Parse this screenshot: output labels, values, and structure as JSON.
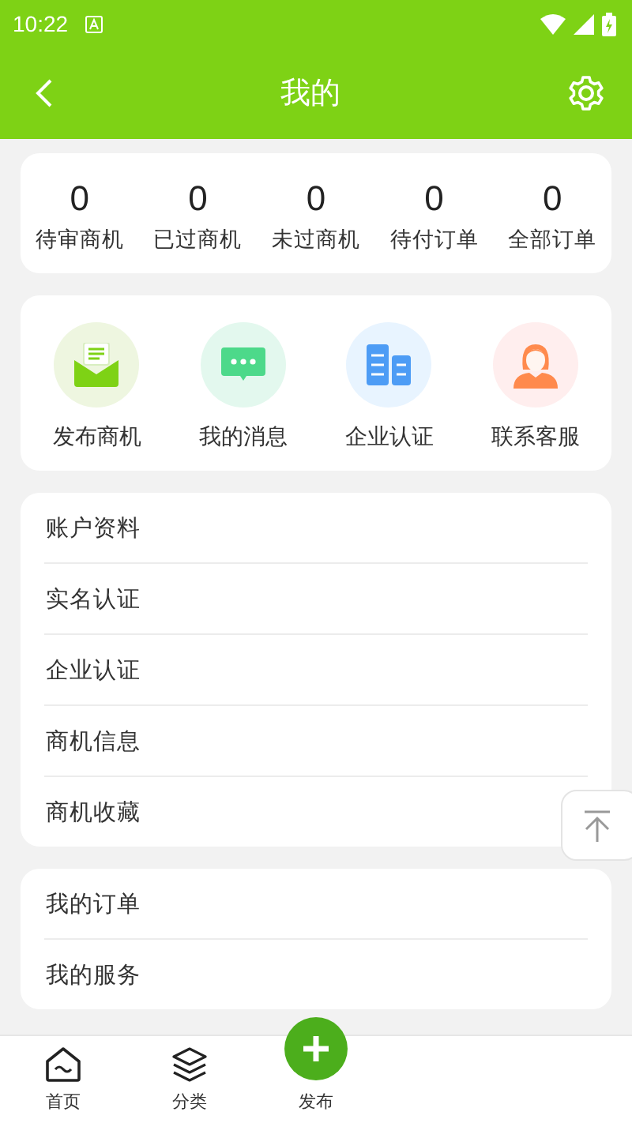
{
  "status_bar": {
    "time": "10:22"
  },
  "header": {
    "title": "我的"
  },
  "stats": [
    {
      "value": "0",
      "label": "待审商机"
    },
    {
      "value": "0",
      "label": "已过商机"
    },
    {
      "value": "0",
      "label": "未过商机"
    },
    {
      "value": "0",
      "label": "待付订单"
    },
    {
      "value": "0",
      "label": "全部订单"
    }
  ],
  "shortcuts": [
    {
      "kind": "envelope",
      "label": "发布商机"
    },
    {
      "kind": "chat",
      "label": "我的消息"
    },
    {
      "kind": "building",
      "label": "企业认证"
    },
    {
      "kind": "agent",
      "label": "联系客服"
    }
  ],
  "menu_groups": [
    {
      "items": [
        "账户资料",
        "实名认证",
        "企业认证",
        "商机信息",
        "商机收藏"
      ]
    },
    {
      "items": [
        "我的订单",
        "我的服务"
      ]
    }
  ],
  "bottom_nav": [
    {
      "kind": "home",
      "label": "首页"
    },
    {
      "kind": "layers",
      "label": "分类"
    },
    {
      "kind": "publish",
      "label": "发布"
    }
  ]
}
